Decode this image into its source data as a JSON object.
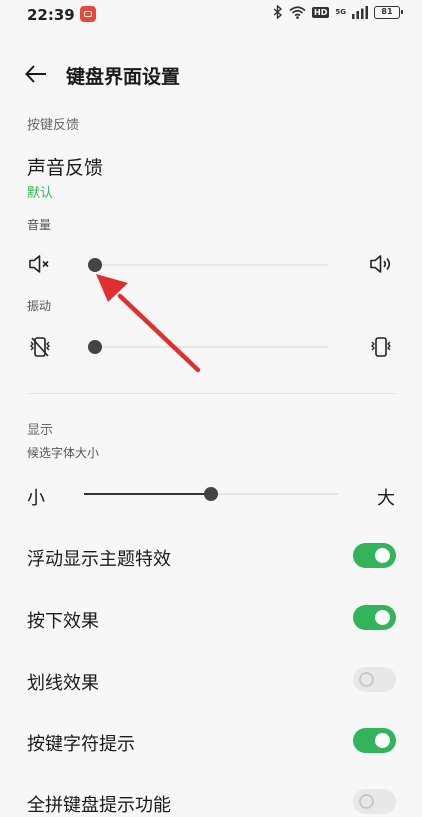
{
  "status_bar": {
    "time": "22:39",
    "network": "5G",
    "network_sub": "HD",
    "battery": "81"
  },
  "header": {
    "title": "键盘界面设置"
  },
  "key_feedback": {
    "section_label": "按键反馈",
    "sound_title": "声音反馈",
    "sound_subtitle": "默认",
    "volume_label": "音量",
    "volume_value": 0,
    "vibration_label": "振动",
    "vibration_value": 0
  },
  "display": {
    "section_label": "显示",
    "font_size_label": "候选字体大小",
    "font_small": "小",
    "font_large": "大",
    "font_size_value": 0.5
  },
  "toggles": [
    {
      "label": "浮动显示主题特效",
      "on": true
    },
    {
      "label": "按下效果",
      "on": true
    },
    {
      "label": "划线效果",
      "on": false
    },
    {
      "label": "按键字符提示",
      "on": true
    },
    {
      "label": "全拼键盘提示功能",
      "on": false
    }
  ],
  "colors": {
    "accent_green": "#34b45a",
    "annotation_red": "#e02f2f"
  }
}
